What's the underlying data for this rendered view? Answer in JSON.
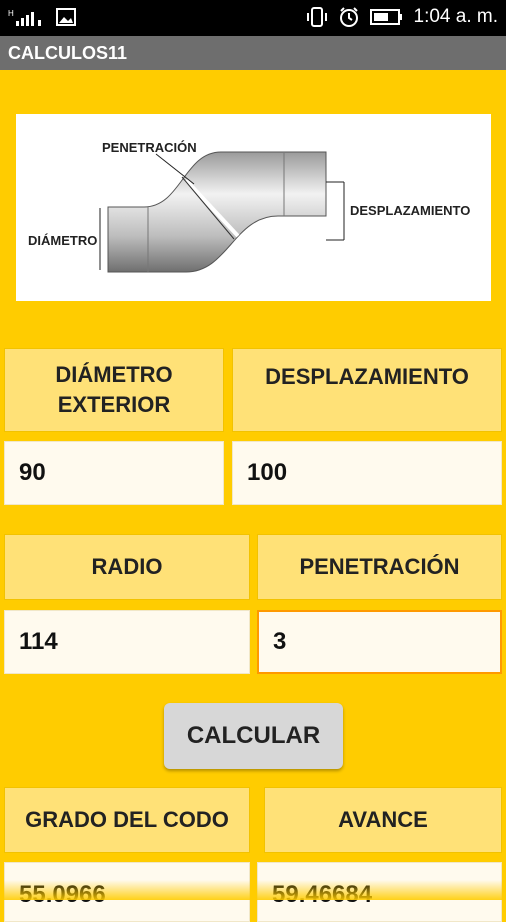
{
  "status_bar": {
    "left_icons": [
      "signal-icon",
      "image-icon"
    ],
    "right_icons": [
      "vibrate-icon",
      "alarm-icon",
      "battery-icon"
    ],
    "time": "1:04 a. m."
  },
  "app": {
    "title": "CALCULOS11"
  },
  "diagram": {
    "label_penetracion": "PENETRACIÓN",
    "label_desplazamiento": "DESPLAZAMIENTO",
    "label_diametro": "DIÁMETRO"
  },
  "fields": {
    "diametro": {
      "label_line1": "DIÁMETRO",
      "label_line2": "EXTERIOR",
      "value": "90"
    },
    "desplazamiento": {
      "label": "DESPLAZAMIENTO",
      "value": "100"
    },
    "radio": {
      "label": "RADIO",
      "value": "114"
    },
    "penetracion": {
      "label": "PENETRACIÓN",
      "value": "3"
    }
  },
  "button": {
    "calcular": "CALCULAR"
  },
  "results": {
    "grado": {
      "label": "GRADO DEL CODO",
      "value": "55.0966"
    },
    "avance": {
      "label": "AVANCE",
      "value": "59.46684"
    }
  }
}
